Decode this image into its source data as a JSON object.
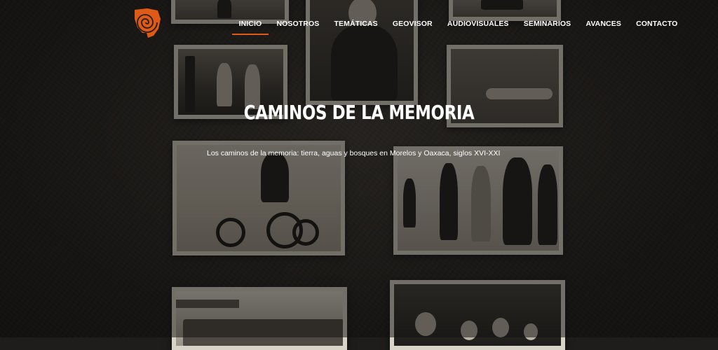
{
  "header": {
    "logo_icon": "spiral-logo-icon",
    "nav": [
      {
        "label": "INICIO",
        "active": true
      },
      {
        "label": "NOSOTROS",
        "active": false
      },
      {
        "label": "TEMÁTICAS",
        "active": false
      },
      {
        "label": "GEOVISOR",
        "active": false
      },
      {
        "label": "AUDIOVISUALES",
        "active": false
      },
      {
        "label": "SEMINARIOS",
        "active": false
      },
      {
        "label": "AVANCES",
        "active": false
      },
      {
        "label": "CONTACTO",
        "active": false
      }
    ]
  },
  "hero": {
    "title": "CAMINOS DE LA MEMORIA",
    "subtitle": "Los caminos de la memoria: tierra, aguas y bosques en Morelos y Oaxaca, siglos XVI-XXI"
  },
  "colors": {
    "accent": "#e05a17",
    "background": "#1f1d1b",
    "text": "#ffffff"
  }
}
